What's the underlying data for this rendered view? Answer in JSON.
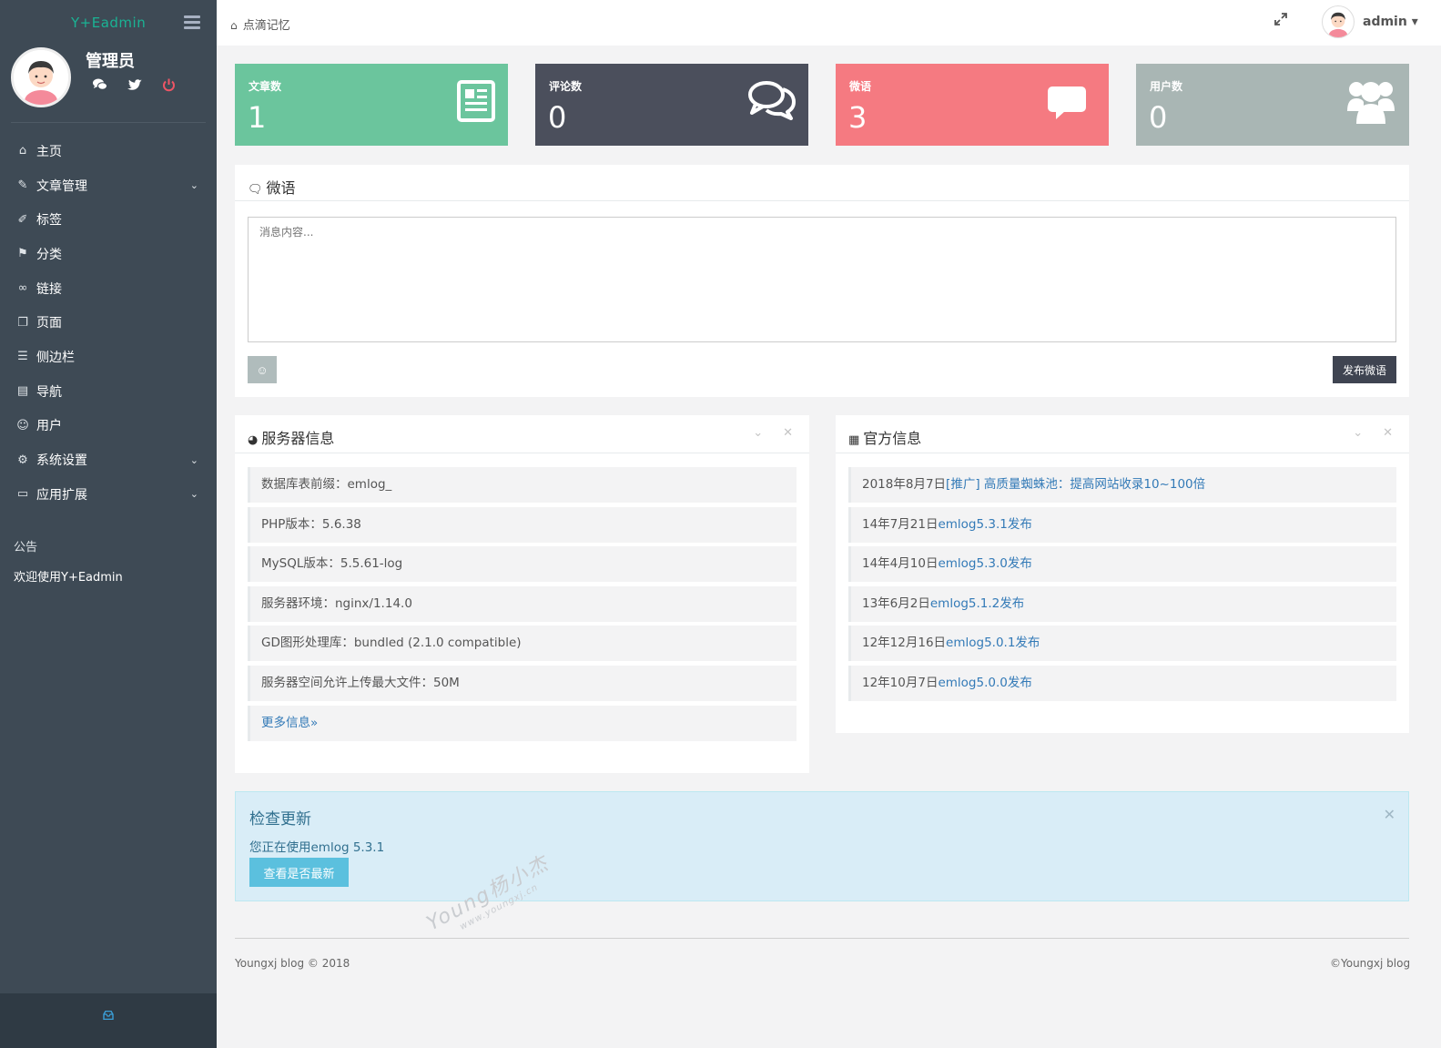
{
  "sidebar": {
    "brand": "Y+Eadmin",
    "profile_name": "管理员",
    "items": [
      {
        "label": "主页",
        "icon": "home-icon",
        "glyph": "⌂",
        "caret": false
      },
      {
        "label": "文章管理",
        "icon": "feather-icon",
        "glyph": "✎",
        "caret": true
      },
      {
        "label": "标签",
        "icon": "tag-icon",
        "glyph": "✐",
        "caret": false
      },
      {
        "label": "分类",
        "icon": "flag-icon",
        "glyph": "⚑",
        "caret": false
      },
      {
        "label": "链接",
        "icon": "link-icon",
        "glyph": "∞",
        "caret": false
      },
      {
        "label": "页面",
        "icon": "pages-icon",
        "glyph": "❐",
        "caret": false
      },
      {
        "label": "侧边栏",
        "icon": "list-icon",
        "glyph": "☰",
        "caret": false
      },
      {
        "label": "导航",
        "icon": "document-icon",
        "glyph": "▤",
        "caret": false
      },
      {
        "label": "用户",
        "icon": "users-icon",
        "glyph": "☺",
        "caret": false
      },
      {
        "label": "系统设置",
        "icon": "gear-icon",
        "glyph": "⚙",
        "caret": true
      },
      {
        "label": "应用扩展",
        "icon": "archive-icon",
        "glyph": "▭",
        "caret": true
      }
    ],
    "notice_title": "公告",
    "notice_body": "欢迎使用Y+Eadmin"
  },
  "topbar": {
    "breadcrumb": "点滴记忆",
    "username": "admin",
    "username_caret": "▾"
  },
  "stats": [
    {
      "label": "文章数",
      "value": "1",
      "icon": "newspaper-icon",
      "color": "#6bc59d"
    },
    {
      "label": "评论数",
      "value": "0",
      "icon": "comments-icon",
      "color": "#4b4f5c"
    },
    {
      "label": "微语",
      "value": "3",
      "icon": "comment-icon",
      "color": "#f57a81"
    },
    {
      "label": "用户数",
      "value": "0",
      "icon": "users-group-icon",
      "color": "#a9b6b4"
    }
  ],
  "weiyu": {
    "title": "微语",
    "placeholder": "消息内容...",
    "emoji_label": "☺",
    "post_label": "发布微语"
  },
  "server": {
    "title": "服务器信息",
    "items": [
      "数据库表前缀：emlog_",
      "PHP版本：5.6.38",
      "MySQL版本：5.5.61-log",
      "服务器环境：nginx/1.14.0",
      "GD图形处理库：bundled (2.1.0 compatible)",
      "服务器空间允许上传最大文件：50M"
    ],
    "more_link": "更多信息»"
  },
  "official": {
    "title": "官方信息",
    "items": [
      {
        "date": "2018年8月7日",
        "link": "[推广] 高质量蜘蛛池：提高网站收录10~100倍"
      },
      {
        "date": "14年7月21日",
        "link": "emlog5.3.1发布"
      },
      {
        "date": "14年4月10日",
        "link": "emlog5.3.0发布"
      },
      {
        "date": "13年6月2日",
        "link": "emlog5.1.2发布"
      },
      {
        "date": "12年12月16日",
        "link": "emlog5.0.1发布"
      },
      {
        "date": "12年10月7日",
        "link": "emlog5.0.0发布"
      }
    ]
  },
  "update": {
    "title": "检查更新",
    "text": "您正在使用emlog 5.3.1",
    "button": "查看是否最新"
  },
  "footer": {
    "left": "Youngxj blog © 2018",
    "right": "©Youngxj blog"
  },
  "watermark": {
    "line1": "Young杨小杰",
    "line2": "www.youngxj.cn"
  },
  "colors": {
    "sidebar_bg": "#3e4a55",
    "brand_green": "#1ab394",
    "link_blue": "#337ab7",
    "power_red": "#ed5565"
  }
}
